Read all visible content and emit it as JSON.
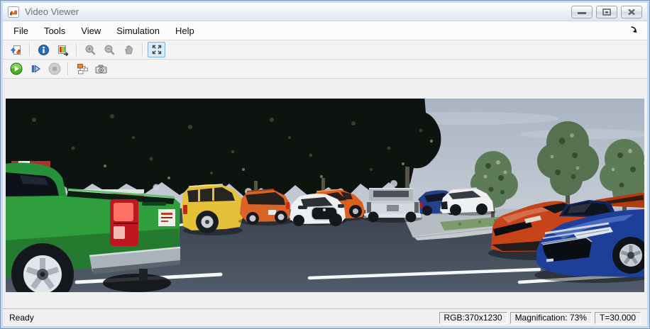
{
  "window": {
    "title": "Video Viewer",
    "icon": "matlab-logo-icon",
    "controls": [
      {
        "name": "minimize-button"
      },
      {
        "name": "restore-button"
      },
      {
        "name": "close-button"
      }
    ]
  },
  "menu": {
    "items": [
      "File",
      "Tools",
      "View",
      "Simulation",
      "Help"
    ],
    "overflow_arrow": "dock-arrow-icon"
  },
  "toolbar_main": {
    "buttons": [
      {
        "name": "export-image",
        "disabled": false,
        "selected": false
      },
      {
        "name": "video-information",
        "disabled": false,
        "selected": false
      },
      {
        "name": "colormap-settings",
        "disabled": false,
        "selected": false
      },
      {
        "name": "zoom-in",
        "disabled": true,
        "selected": false
      },
      {
        "name": "zoom-out",
        "disabled": true,
        "selected": false
      },
      {
        "name": "pan",
        "disabled": true,
        "selected": false
      },
      {
        "name": "maintain-fit-to-window",
        "disabled": false,
        "selected": true
      }
    ]
  },
  "toolbar_playback": {
    "buttons": [
      {
        "name": "play",
        "disabled": false
      },
      {
        "name": "step-forward",
        "disabled": false
      },
      {
        "name": "stop",
        "disabled": true
      },
      {
        "name": "highlight-simulink-signal",
        "disabled": false
      },
      {
        "name": "snapshot",
        "disabled": false
      }
    ]
  },
  "status_bar": {
    "message": "Ready",
    "panels": [
      {
        "label": "RGB:370x1230"
      },
      {
        "label": "Magnification: 73%"
      },
      {
        "label": "T=30.000"
      }
    ]
  },
  "scene": {
    "type": "video-frame",
    "subject": "3D rendered parking lot with parked vehicles and trees",
    "colors": {
      "sky_top": "#a9b3c2",
      "sky_bottom": "#dde1e7",
      "trees_dark": "#0d130e",
      "trees_light": "#5e7b57",
      "trees_light_b": "#55714f",
      "tree_trunk": "#565349",
      "far_sidewalk": "#c9cfd6",
      "near_pavement": "#b6bcc3",
      "asphalt_top": "#373f4b",
      "asphalt_bottom": "#515b69",
      "grass": "#7c9a6b",
      "curb": "#c6cacd",
      "marking": "#ffffff"
    },
    "vehicles": [
      {
        "name": "green-pickup-truck",
        "color": "#2f9e3d"
      },
      {
        "name": "yellow-suv",
        "color": "#e4c138"
      },
      {
        "name": "orange-hatchback",
        "color": "#d96427"
      },
      {
        "name": "white-compact-car",
        "color": "#eef0f2"
      },
      {
        "name": "orange-suv",
        "color": "#dd5f1e"
      },
      {
        "name": "silver-pickup-truck",
        "color": "#c6ccd2"
      },
      {
        "name": "blue-compact-car",
        "color": "#24418c"
      },
      {
        "name": "white-suv",
        "color": "#eef0f2"
      },
      {
        "name": "orange-coupe",
        "color": "#c7441a"
      },
      {
        "name": "blue-sedan",
        "color": "#1d3f9a"
      },
      {
        "name": "distant-red-car",
        "color": "#a93428"
      },
      {
        "name": "partial-orange-car",
        "color": "#b23c10"
      }
    ]
  }
}
